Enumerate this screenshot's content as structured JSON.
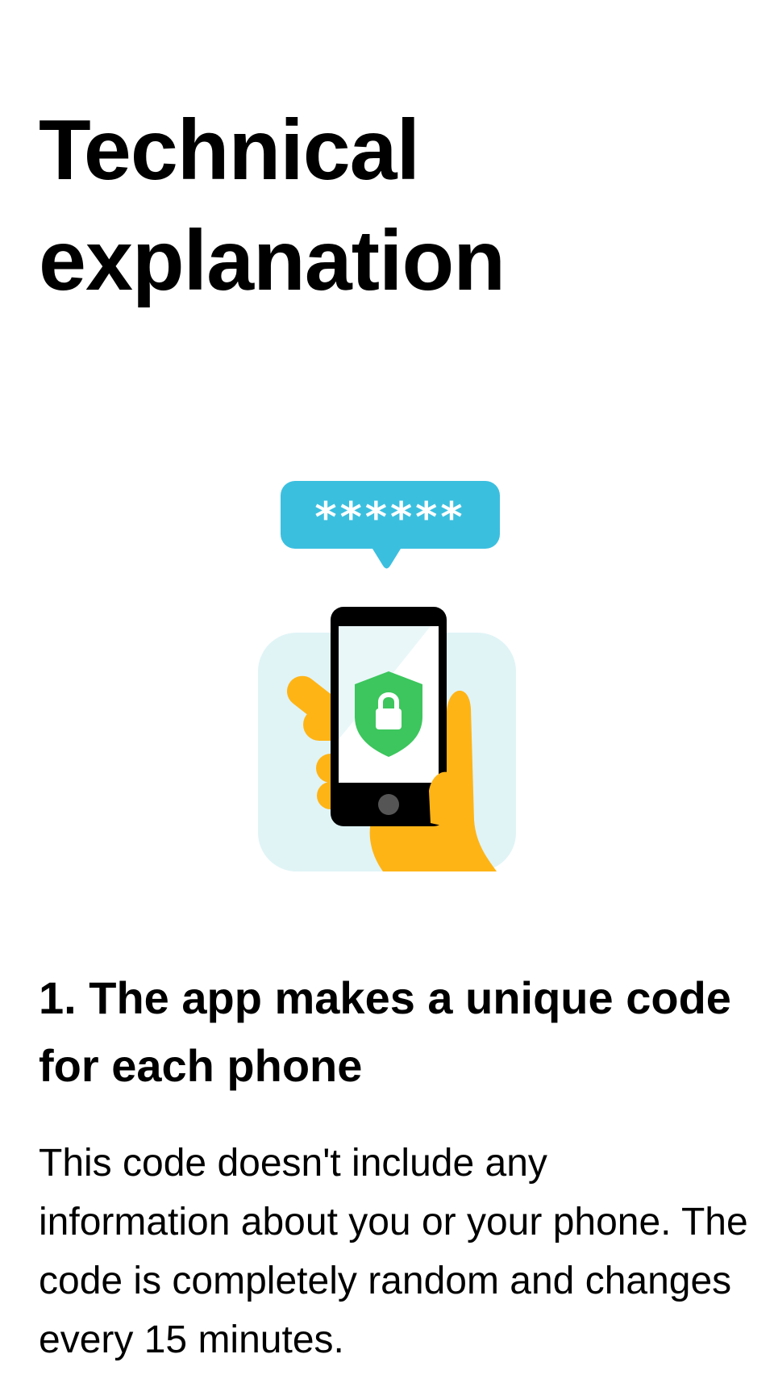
{
  "page": {
    "title": "Technical explanation"
  },
  "illustration": {
    "icon": "phone-with-shield-lock-and-code-bubble",
    "bubble_text": "******",
    "colors": {
      "bubble": "#3bbfdf",
      "card_background": "#e0f4f6",
      "hand": "#ffb416",
      "phone": "#000000",
      "screen": "#ffffff",
      "shield": "#3cc65d"
    }
  },
  "section": {
    "heading": "1. The app makes a unique code for each phone",
    "body": "This code doesn't include any information about you or your phone. The code is completely random and changes every 15 minutes."
  }
}
